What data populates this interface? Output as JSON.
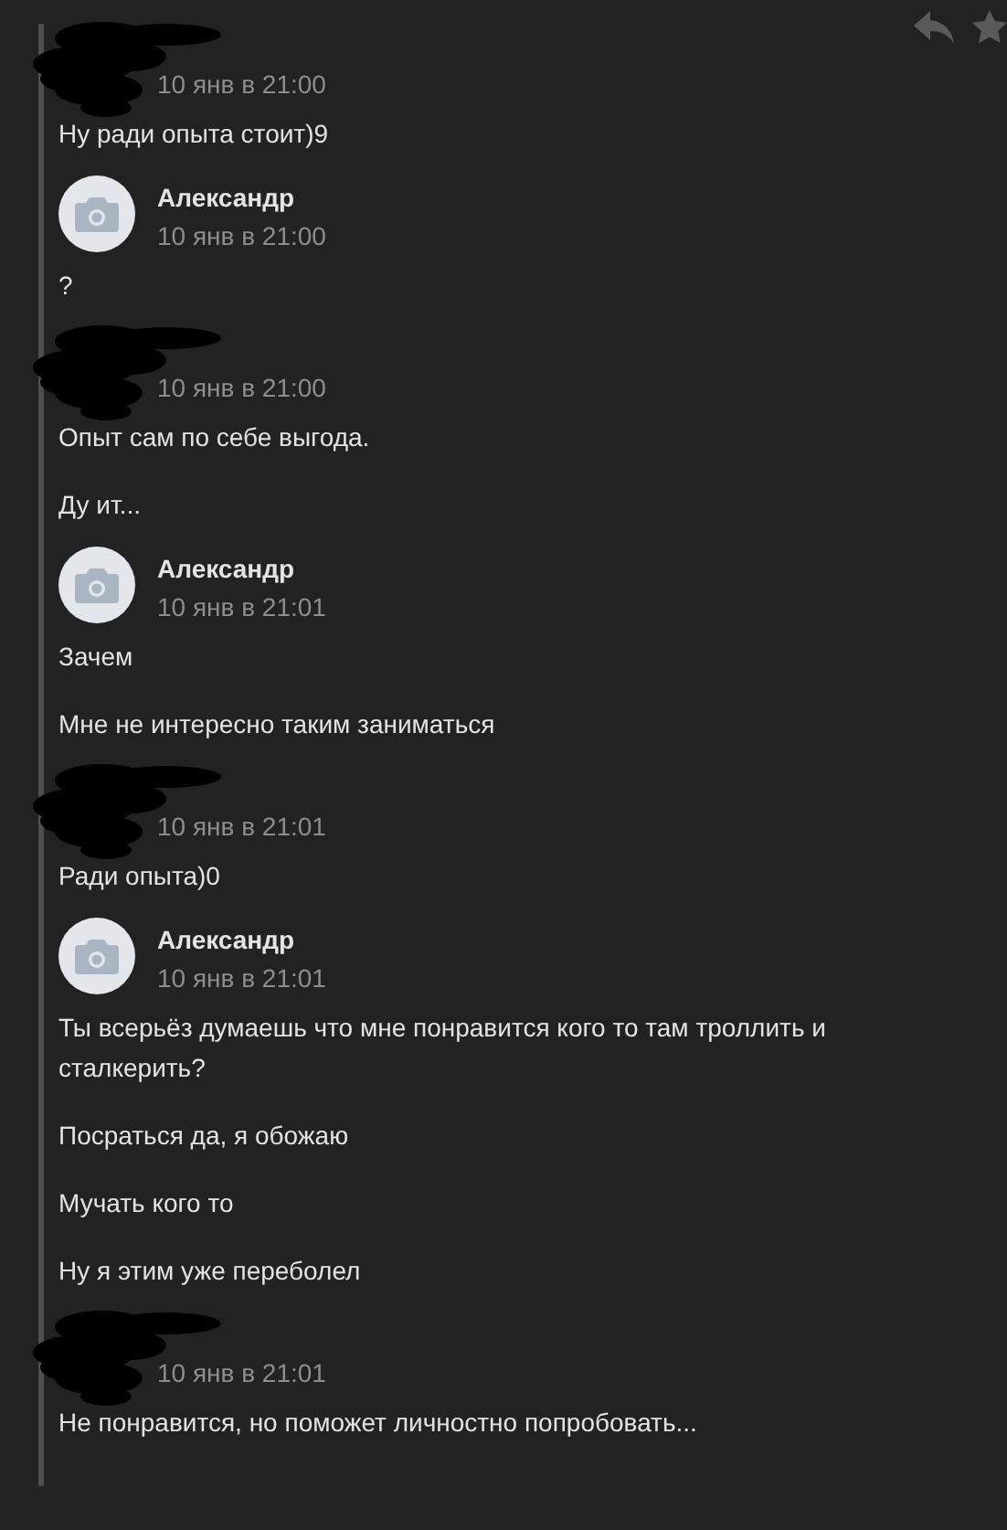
{
  "groups": [
    {
      "kind": "redacted",
      "time": "10 янв в 21:00",
      "messages": [
        "Ну ради опыта стоит)9"
      ]
    },
    {
      "kind": "named",
      "author": "Александр",
      "time": "10 янв в 21:00",
      "messages": [
        "?"
      ]
    },
    {
      "kind": "redacted",
      "time": "10 янв в 21:00",
      "messages": [
        "Опыт сам по себе выгода.",
        "Ду ит..."
      ]
    },
    {
      "kind": "named",
      "author": "Александр",
      "time": "10 янв в 21:01",
      "messages": [
        "Зачем",
        "Мне не интересно таким заниматься"
      ]
    },
    {
      "kind": "redacted",
      "time": "10 янв в 21:01",
      "messages": [
        "Ради опыта)0"
      ]
    },
    {
      "kind": "named",
      "author": "Александр",
      "time": "10 янв в 21:01",
      "messages": [
        "Ты всерьёз думаешь что мне понравится кого то там троллить и сталкерить?",
        "Посраться да, я обожаю",
        "Мучать кого то",
        "Ну я этим уже переболел"
      ]
    },
    {
      "kind": "redacted",
      "time": "10 янв в 21:01",
      "messages": [
        "Не понравится, но поможет личностно попробовать..."
      ]
    }
  ]
}
